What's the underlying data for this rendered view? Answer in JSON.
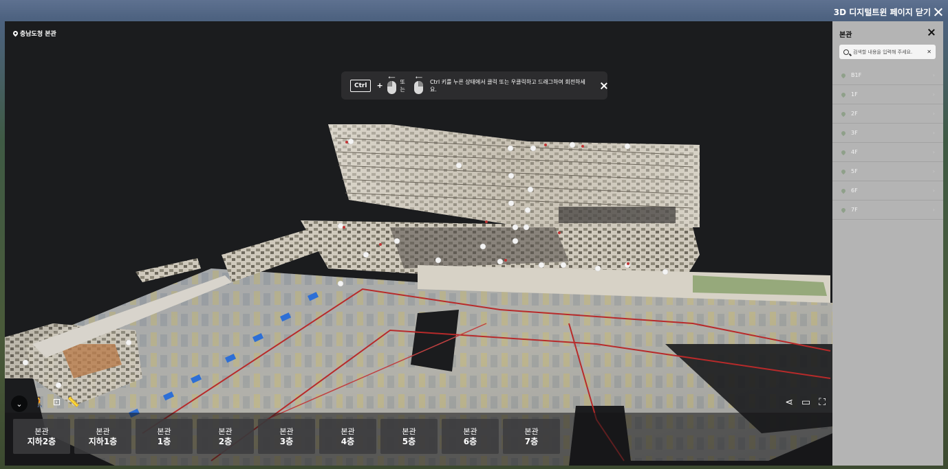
{
  "header": {
    "close_label": "3D 디지털트윈 페이지 닫기"
  },
  "viewer": {
    "location": "충남도청 본관",
    "hint": {
      "key": "Ctrl",
      "plus": "+",
      "or": "또는",
      "text": "Ctrl 키를 누른 상태에서 클릭 또는 우클릭하고 드래그하여 회전하세요."
    }
  },
  "floor_buttons": [
    {
      "building": "본관",
      "floor": "지하2층"
    },
    {
      "building": "본관",
      "floor": "지하1층"
    },
    {
      "building": "본관",
      "floor": "1층"
    },
    {
      "building": "본관",
      "floor": "2층"
    },
    {
      "building": "본관",
      "floor": "3층"
    },
    {
      "building": "본관",
      "floor": "4층"
    },
    {
      "building": "본관",
      "floor": "5층"
    },
    {
      "building": "본관",
      "floor": "6층"
    },
    {
      "building": "본관",
      "floor": "7층"
    }
  ],
  "panel": {
    "title": "본관",
    "search_placeholder": "검색할 내용을 입력해 주세요.",
    "floors": [
      "B1F",
      "1F",
      "2F",
      "3F",
      "4F",
      "5F",
      "6F",
      "7F"
    ]
  },
  "icons": {
    "chevron": "chevron-down-icon",
    "walk": "walk-icon",
    "floorplan": "floorplan-icon",
    "measure": "measure-icon",
    "share": "share-icon",
    "vr": "vr-icon",
    "fullscreen": "fullscreen-icon"
  }
}
